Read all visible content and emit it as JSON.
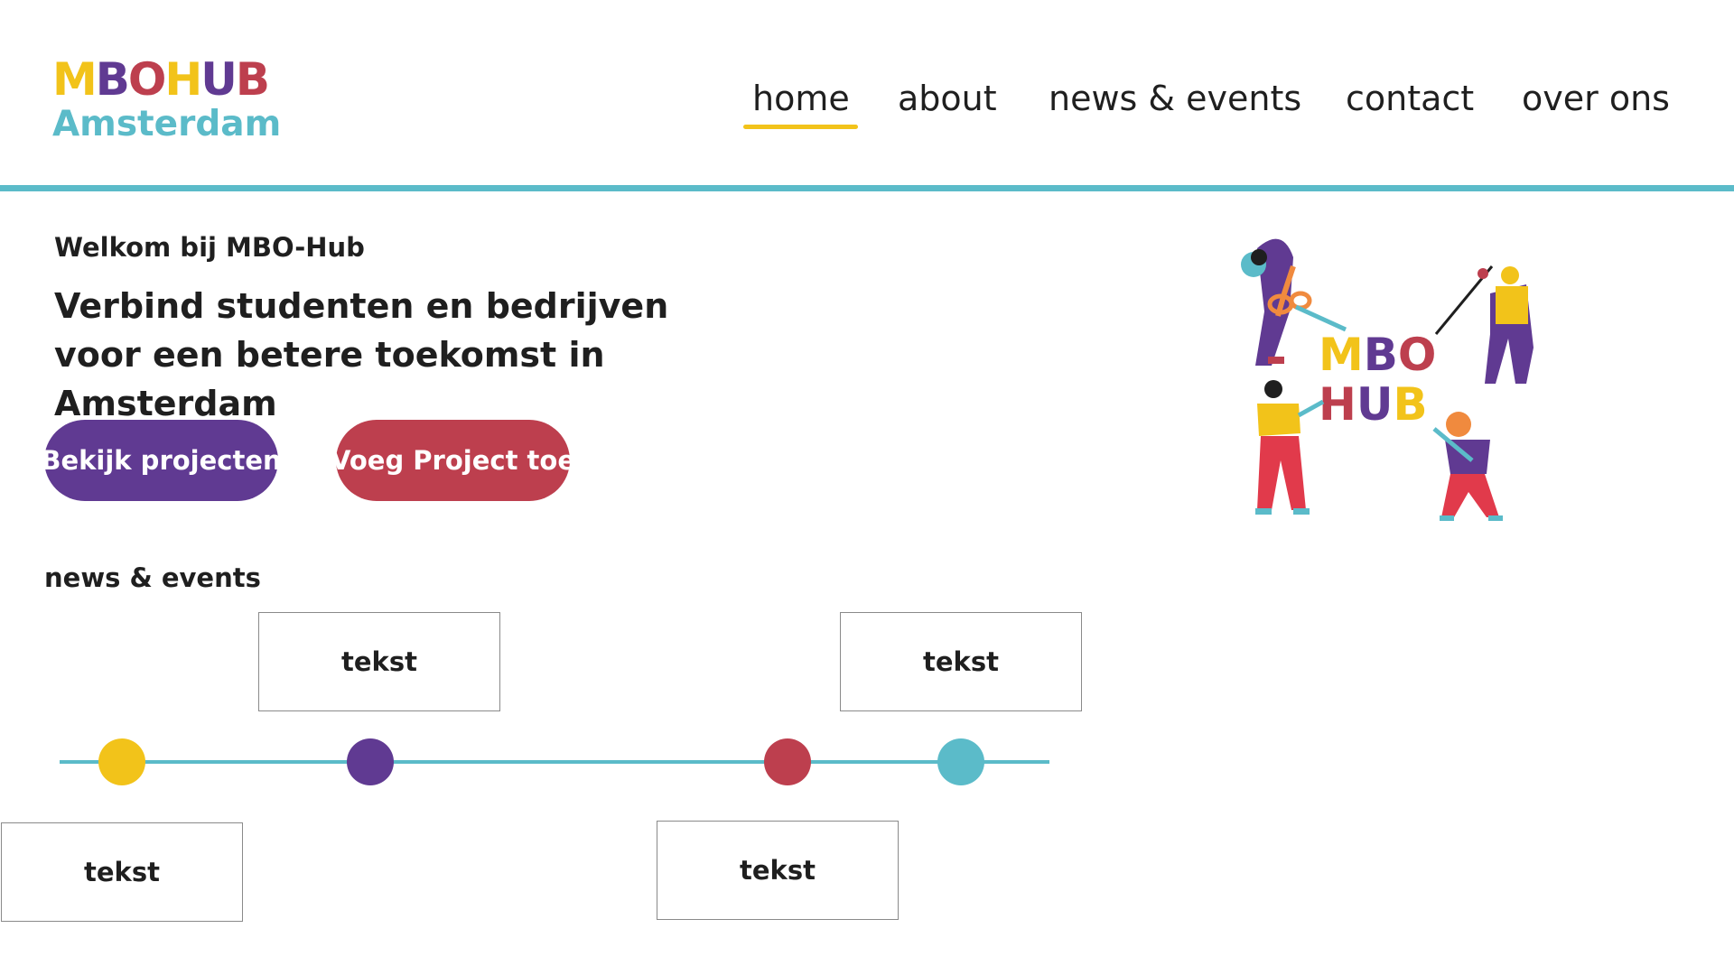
{
  "colors": {
    "yellow": "#f2c31a",
    "purple": "#603a92",
    "red": "#bd3f4e",
    "teal": "#5bbbc9",
    "text": "#1f1f1f"
  },
  "logo": {
    "line1_letters": [
      {
        "ch": "M",
        "color": "#f2c31a"
      },
      {
        "ch": "B",
        "color": "#603a92"
      },
      {
        "ch": "O",
        "color": "#bd3f4e"
      },
      {
        "ch": "H",
        "color": "#f2c31a"
      },
      {
        "ch": "U",
        "color": "#603a92"
      },
      {
        "ch": "B",
        "color": "#bd3f4e"
      }
    ],
    "line2": "Amsterdam"
  },
  "nav": {
    "items": [
      "home",
      "about",
      "news & events",
      "contact",
      "over ons"
    ],
    "active": "home"
  },
  "hero": {
    "welcome": "Welkom bij MBO-Hub",
    "headline": "Verbind studenten en bedrijven voor een betere toekomst in Amsterdam",
    "button_projects": "Bekijk projecten",
    "button_add": "Voeg Project toe",
    "illustration_text": [
      "MBO",
      "HUB"
    ]
  },
  "news": {
    "title": "news & events",
    "boxes": [
      "tekst",
      "tekst",
      "tekst",
      "tekst"
    ],
    "dots": [
      "yellow",
      "purple",
      "red",
      "teal"
    ]
  }
}
